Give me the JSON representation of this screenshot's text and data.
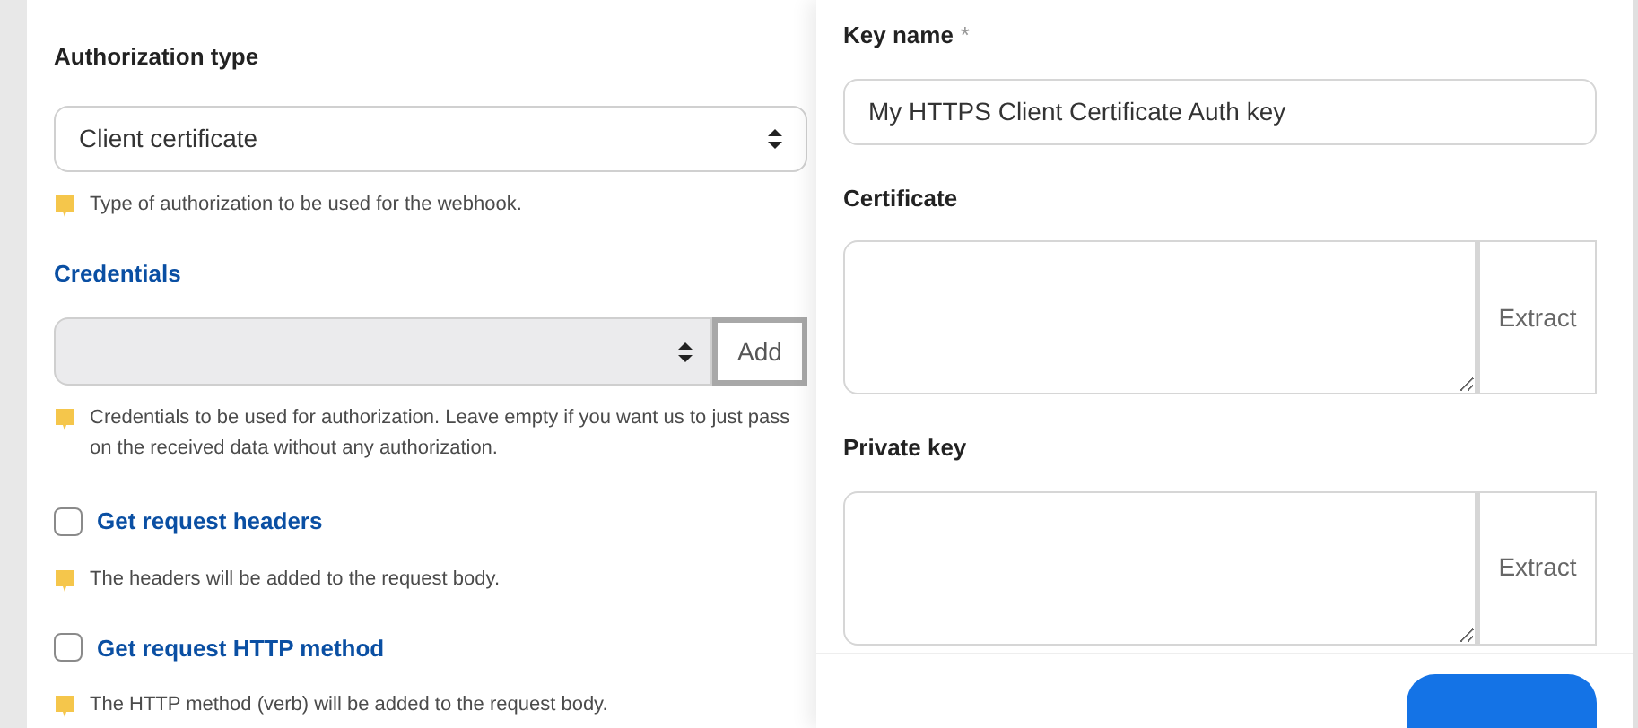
{
  "webhook_form": {
    "authorization_type": {
      "label": "Authorization type",
      "value": "Client certificate",
      "hint": "Type of authorization to be used for the webhook."
    },
    "credentials": {
      "label": "Credentials",
      "add_button": "Add",
      "hint": "Credentials to be used for authorization. Leave empty if you want us to just pass on the received data without any authorization."
    },
    "options": [
      {
        "label": "Get request headers",
        "checked": false,
        "hint": "The headers will be added to the request body."
      },
      {
        "label": "Get request HTTP method",
        "checked": false,
        "hint": "The HTTP method (verb) will be added to the request body."
      }
    ]
  },
  "key_dialog": {
    "key_name": {
      "label": "Key name",
      "required_mark": "*",
      "value": "My HTTPS Client Certificate Auth key"
    },
    "fields": [
      {
        "label": "Certificate",
        "button": "Extract"
      },
      {
        "label": "Private key",
        "button": "Extract"
      }
    ]
  }
}
